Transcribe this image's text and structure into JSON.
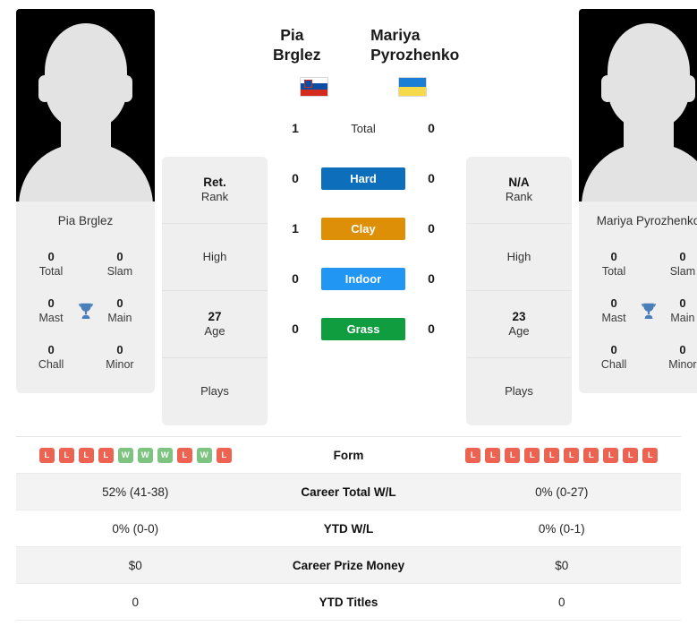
{
  "players": {
    "left": {
      "name": "Pia Brglez",
      "flag": "slovenia-flag",
      "avatar_label": "Pia Brglez",
      "rank_value": "Ret.",
      "rank_label": "Rank",
      "high_label": "High",
      "high_value": "",
      "age_value": "27",
      "age_label": "Age",
      "plays_label": "Plays",
      "plays_value": "",
      "titles": {
        "total_value": "0",
        "total_label": "Total",
        "slam_value": "0",
        "slam_label": "Slam",
        "mast_value": "0",
        "mast_label": "Mast",
        "main_value": "0",
        "main_label": "Main",
        "chall_value": "0",
        "chall_label": "Chall",
        "minor_value": "0",
        "minor_label": "Minor"
      },
      "form": [
        "L",
        "L",
        "L",
        "L",
        "W",
        "W",
        "W",
        "L",
        "W",
        "L"
      ],
      "career_wl": "52% (41-38)",
      "ytd_wl": "0% (0-0)",
      "prize_money": "$0",
      "ytd_titles": "0"
    },
    "right": {
      "name": "Mariya Pyrozhenko",
      "flag": "ukraine-flag",
      "avatar_label": "Mariya Pyrozhenko",
      "rank_value": "N/A",
      "rank_label": "Rank",
      "high_label": "High",
      "high_value": "",
      "age_value": "23",
      "age_label": "Age",
      "plays_label": "Plays",
      "plays_value": "",
      "titles": {
        "total_value": "0",
        "total_label": "Total",
        "slam_value": "0",
        "slam_label": "Slam",
        "mast_value": "0",
        "mast_label": "Mast",
        "main_value": "0",
        "main_label": "Main",
        "chall_value": "0",
        "chall_label": "Chall",
        "minor_value": "0",
        "minor_label": "Minor"
      },
      "form": [
        "L",
        "L",
        "L",
        "L",
        "L",
        "L",
        "L",
        "L",
        "L",
        "L"
      ],
      "career_wl": "0% (0-27)",
      "ytd_wl": "0% (0-1)",
      "prize_money": "$0",
      "ytd_titles": "0"
    }
  },
  "h2h": [
    {
      "label": "Total",
      "left": "1",
      "right": "0",
      "color": ""
    },
    {
      "label": "Hard",
      "left": "0",
      "right": "0",
      "color": "#0d6fbc"
    },
    {
      "label": "Clay",
      "left": "1",
      "right": "0",
      "color": "#dd8f08"
    },
    {
      "label": "Indoor",
      "left": "0",
      "right": "0",
      "color": "#2196f3"
    },
    {
      "label": "Grass",
      "left": "0",
      "right": "0",
      "color": "#0f9d3f"
    }
  ],
  "comparison": {
    "form_label": "Form",
    "career_wl_label": "Career Total W/L",
    "ytd_wl_label": "YTD W/L",
    "prize_money_label": "Career Prize Money",
    "ytd_titles_label": "YTD Titles"
  },
  "colors": {
    "win": "#7cc47f",
    "loss": "#ec6352",
    "trophy": "#4a7ebb",
    "card_bg": "#efefef"
  }
}
